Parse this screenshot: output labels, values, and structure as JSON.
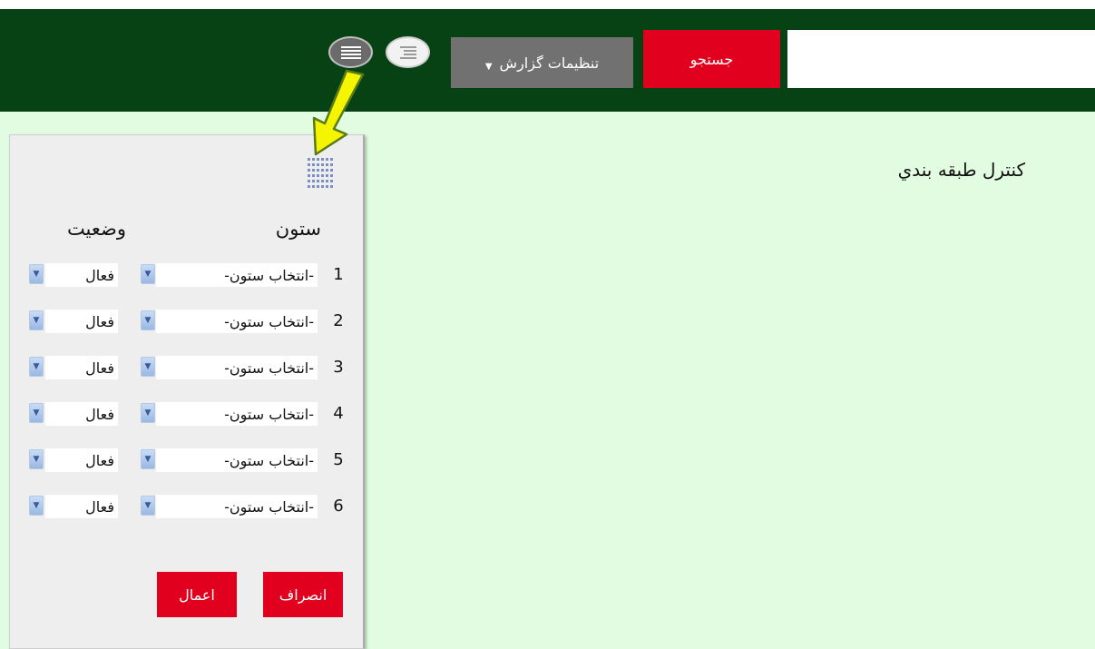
{
  "header": {
    "search_placeholder": "",
    "search_button": "جستجو",
    "report_settings": "تنظيمات گزارش",
    "caret": "▼"
  },
  "panel": {
    "title": "کنترل طبقه بندي",
    "column_header": "ستون",
    "status_header": "وضعيت",
    "rows": [
      {
        "num": "1",
        "column": "-انتخاب ستون-",
        "status": "فعال"
      },
      {
        "num": "2",
        "column": "-انتخاب ستون-",
        "status": "فعال"
      },
      {
        "num": "3",
        "column": "-انتخاب ستون-",
        "status": "فعال"
      },
      {
        "num": "4",
        "column": "-انتخاب ستون-",
        "status": "فعال"
      },
      {
        "num": "5",
        "column": "-انتخاب ستون-",
        "status": "فعال"
      },
      {
        "num": "6",
        "column": "-انتخاب ستون-",
        "status": "فعال"
      }
    ],
    "cancel_button": "انصراف",
    "apply_button": "اعمال"
  },
  "colors": {
    "header_bg": "#064214",
    "accent_red": "#e2001f",
    "content_bg": "#e1fce0",
    "arrow_yellow": "#f5f500"
  },
  "icons": [
    "grid-icon",
    "list-view-icon",
    "detail-view-icon",
    "dropdown-arrow-icon",
    "yellow-arrow-annotation"
  ]
}
